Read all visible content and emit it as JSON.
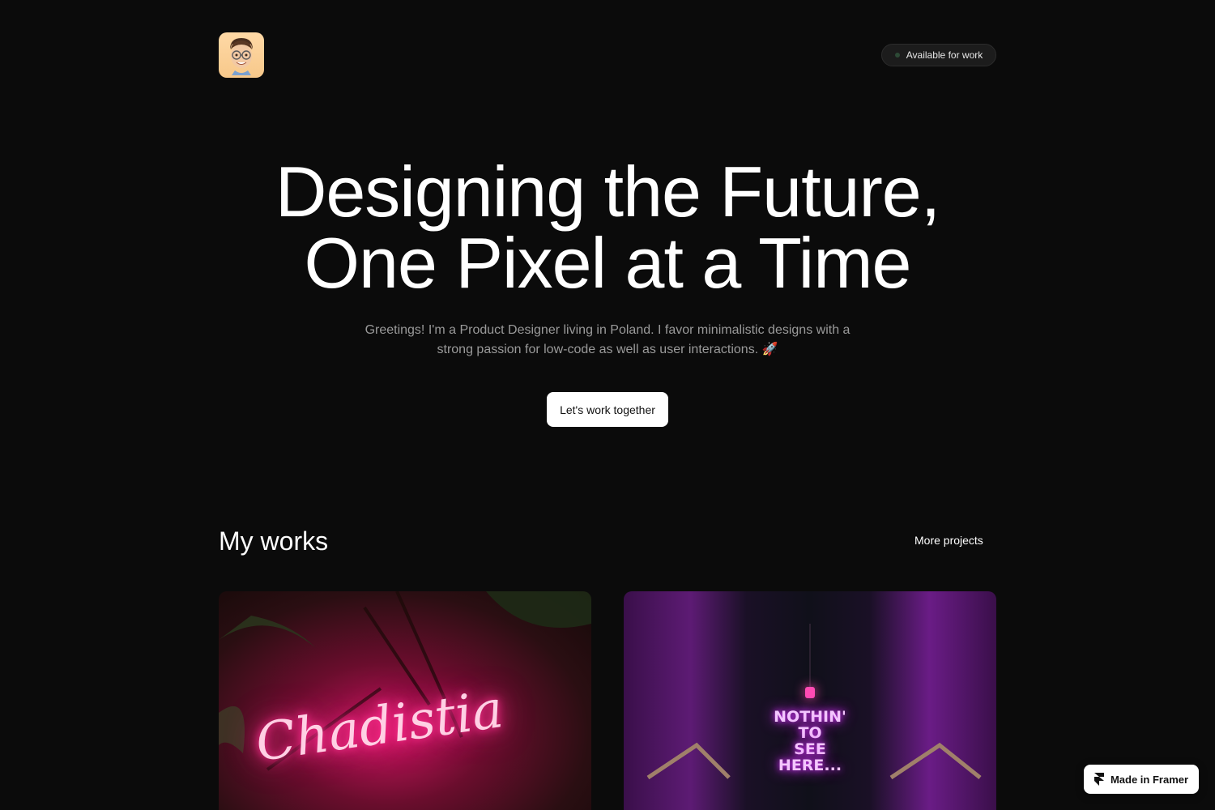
{
  "header": {
    "status_label": "Available for work"
  },
  "hero": {
    "title_line1": "Designing the Future,",
    "title_line2": "One Pixel at a Time",
    "subtitle_line1": "Greetings! I'm a Product Designer living in Poland. I favor minimalistic designs with a",
    "subtitle_line2": "strong passion for low-code as well as user interactions. 🚀",
    "cta_label": "Let's work together"
  },
  "works": {
    "title": "My works",
    "more_label": "More projects",
    "cards": [
      {
        "neon_text": "Chadistia"
      },
      {
        "neon_line1": "NOTHIN' TO",
        "neon_line2": "SEE HERE..."
      }
    ]
  },
  "badge": {
    "label": "Made in Framer"
  },
  "colors": {
    "background": "#0b0b0b",
    "status_dot": "#2d4a36",
    "subtitle": "#9a9a9a"
  }
}
